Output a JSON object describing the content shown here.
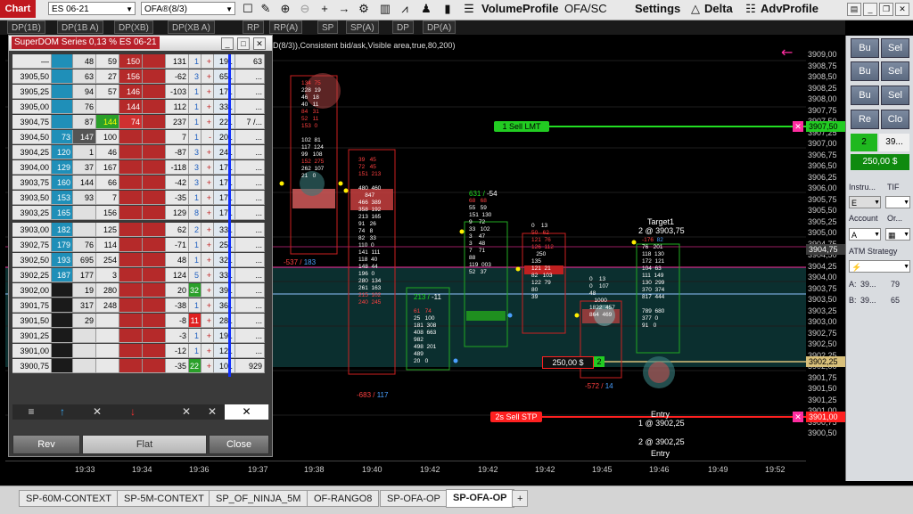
{
  "toolbar": {
    "chart_label": "Chart",
    "instrument": "ES 06-21",
    "indicator": "OFA®(8/3)",
    "volume_profile": "VolumeProfile",
    "ofa_sc": "OFA/SC",
    "settings": "Settings",
    "delta": "Delta",
    "adv_profile": "AdvProfile"
  },
  "indicator_tabs": [
    "DP(1B)",
    "DP(1B A)",
    "DP(XB)",
    "DP(XB A)",
    "RP",
    "RP(A)",
    "SP",
    "SP(A)",
    "DP",
    "DP(A)"
  ],
  "chart": {
    "header_text": "D(8/3)),Consistent bid/ask,Visible area,true,80,200)",
    "sell_lmt": "1  Sell LMT",
    "sell_stp": "2s  Sell STP",
    "position_pnl": "250,00 $",
    "position_qty": "2",
    "target_label": "Target1",
    "target_price": "2 @ 3903,75",
    "entry1_label": "Entry",
    "entry1_price": "1 @ 3902,25",
    "entry2_price": "2 @ 3902,25",
    "entry2_label": "Entry",
    "colors": {
      "sell": "#ff2020",
      "buy": "#22cc22",
      "magenta": "#ff2da0",
      "teal_zone": "#0b2f2f"
    }
  },
  "price_axis": {
    "labels": [
      "3909,00",
      "3908,75",
      "3908,50",
      "3908,25",
      "3908,00",
      "3907,75",
      "3907,50",
      "3907,25",
      "3907,00",
      "3906,75",
      "3906,50",
      "3906,25",
      "3906,00",
      "3905,75",
      "3905,50",
      "3905,25",
      "3905,00",
      "3904,75",
      "3904,50",
      "3904,25",
      "3904,00",
      "3903,75",
      "3903,50",
      "3903,25",
      "3903,00",
      "3902,75",
      "3902,50",
      "3902,25",
      "3902,00",
      "3901,75",
      "3901,50",
      "3901,25",
      "3901,00",
      "3900,75",
      "3900,50"
    ],
    "marker_lmt": "3907,50",
    "marker_current": "3904,75",
    "marker_entry": "3902,25",
    "marker_stp": "3901,00"
  },
  "time_axis": [
    "19:33",
    "19:34",
    "19:36",
    "19:37",
    "19:38",
    "19:40",
    "19:42",
    "19:42",
    "19:42",
    "19:45",
    "19:46",
    "19:49",
    "19:52"
  ],
  "right_panel": {
    "buy1": "Bu",
    "sell1": "Sel",
    "buy2": "Bu",
    "sell2": "Sel",
    "buy3": "Bu",
    "sell3": "Sel",
    "rev": "Re",
    "close": "Clo",
    "qty": "2",
    "price": "39...",
    "pnl": "250,00 $",
    "instrument_label": "Instru...",
    "tif_label": "TIF",
    "account_label": "Account",
    "order_label": "Or...",
    "atm_label": "ATM Strategy",
    "a_label": "A:",
    "a_val1": "39...",
    "a_val2": "79",
    "b_label": "B:",
    "b_val1": "39...",
    "b_val2": "65"
  },
  "superdom": {
    "title": "SuperDOM Series 0,13 % ES 06-21",
    "rows": [
      {
        "price": "—",
        "c1": "",
        "c2": "48",
        "c3": "59",
        "c4": "150",
        "c5": "",
        "c6": "131",
        "c7": "1",
        "c8": "+",
        "c9": "19..",
        "c10": "63"
      },
      {
        "price": "3905,50",
        "c1": "",
        "c2": "63",
        "c3": "27",
        "c4": "156",
        "c5": "",
        "c6": "-62",
        "c7": "3",
        "c8": "+",
        "c9": "65..",
        "c10": "..."
      },
      {
        "price": "3905,25",
        "c1": "",
        "c2": "94",
        "c3": "57",
        "c4": "146",
        "c5": "",
        "c6": "-103",
        "c7": "1",
        "c8": "+",
        "c9": "17..",
        "c10": "..."
      },
      {
        "price": "3905,00",
        "c1": "",
        "c2": "76",
        "c3": "",
        "c4": "144",
        "c5": "",
        "c6": "112",
        "c7": "1",
        "c8": "+",
        "c9": "33..",
        "c10": "..."
      },
      {
        "price": "3904,75",
        "c1": "",
        "c2": "87",
        "c3": "144",
        "c4": "74",
        "c5": "",
        "c6": "237",
        "c7": "1",
        "c8": "+",
        "c9": "22..",
        "c10": "7 /..."
      },
      {
        "price": "3904,50",
        "c1": "73",
        "c2": "147",
        "c3": "100",
        "c4": "",
        "c5": "",
        "c6": "7",
        "c7": "1",
        "c8": "-",
        "c9": "20..",
        "c10": "..."
      },
      {
        "price": "3904,25",
        "c1": "120",
        "c2": "1",
        "c3": "46",
        "c4": "",
        "c5": "",
        "c6": "-87",
        "c7": "3",
        "c8": "+",
        "c9": "24..",
        "c10": "..."
      },
      {
        "price": "3904,00",
        "c1": "129",
        "c2": "37",
        "c3": "167",
        "c4": "",
        "c5": "",
        "c6": "-118",
        "c7": "3",
        "c8": "+",
        "c9": "17..",
        "c10": "..."
      },
      {
        "price": "3903,75",
        "c1": "160",
        "c2": "144",
        "c3": "66",
        "c4": "",
        "c5": "",
        "c6": "-42",
        "c7": "3",
        "c8": "+",
        "c9": "17..",
        "c10": "..."
      },
      {
        "price": "3903,50",
        "c1": "153",
        "c2": "93",
        "c3": "7",
        "c4": "",
        "c5": "",
        "c6": "-35",
        "c7": "1",
        "c8": "+",
        "c9": "17..",
        "c10": "..."
      },
      {
        "price": "3903,25",
        "c1": "165",
        "c2": "",
        "c3": "156",
        "c4": "",
        "c5": "",
        "c6": "129",
        "c7": "8",
        "c8": "+",
        "c9": "17..",
        "c10": "..."
      },
      {
        "price": "3903,00",
        "c1": "182",
        "c2": "",
        "c3": "125",
        "c4": "",
        "c5": "",
        "c6": "62",
        "c7": "2",
        "c8": "+",
        "c9": "33..",
        "c10": "..."
      },
      {
        "price": "3902,75",
        "c1": "179",
        "c2": "76",
        "c3": "114",
        "c4": "",
        "c5": "",
        "c6": "-71",
        "c7": "1",
        "c8": "+",
        "c9": "25..",
        "c10": "..."
      },
      {
        "price": "3902,50",
        "c1": "193",
        "c2": "695",
        "c3": "254",
        "c4": "",
        "c5": "",
        "c6": "48",
        "c7": "1",
        "c8": "+",
        "c9": "32..",
        "c10": "..."
      },
      {
        "price": "3902,25",
        "c1": "187",
        "c2": "177",
        "c3": "3",
        "c4": "",
        "c5": "",
        "c6": "124",
        "c7": "5",
        "c8": "+",
        "c9": "33..",
        "c10": "..."
      },
      {
        "price": "3902,00",
        "c1": "",
        "c2": "19",
        "c3": "280",
        "c4": "",
        "c5": "",
        "c6": "20",
        "c7": "32",
        "c8": "+",
        "c9": "39..",
        "c10": "..."
      },
      {
        "price": "3901,75",
        "c1": "",
        "c2": "317",
        "c3": "248",
        "c4": "",
        "c5": "",
        "c6": "-38",
        "c7": "1",
        "c8": "+",
        "c9": "36..",
        "c10": "..."
      },
      {
        "price": "3901,50",
        "c1": "",
        "c2": "29",
        "c3": "",
        "c4": "",
        "c5": "",
        "c6": "-8",
        "c7": "11",
        "c8": "+",
        "c9": "28..",
        "c10": "..."
      },
      {
        "price": "3901,25",
        "c1": "",
        "c2": "",
        "c3": "",
        "c4": "",
        "c5": "",
        "c6": "-3",
        "c7": "1",
        "c8": "+",
        "c9": "19..",
        "c10": "..."
      },
      {
        "price": "3901,00",
        "c1": "",
        "c2": "",
        "c3": "",
        "c4": "",
        "c5": "",
        "c6": "-12",
        "c7": "1",
        "c8": "+",
        "c9": "12..",
        "c10": "..."
      },
      {
        "price": "3900,75",
        "c1": "",
        "c2": "",
        "c3": "",
        "c4": "",
        "c5": "",
        "c6": "-35",
        "c7": "22",
        "c8": "+",
        "c9": "10..",
        "c10": "929"
      }
    ],
    "rev": "Rev",
    "flat": "Flat",
    "close": "Close"
  },
  "bottom_tabs": [
    "SP-60M-CONTEXT",
    "SP-5M-CONTEXT",
    "SP_OF_NINJA_5M",
    "OF-RANGO8",
    "SP-OFA-OP",
    "SP-OFA-OP",
    "+"
  ]
}
